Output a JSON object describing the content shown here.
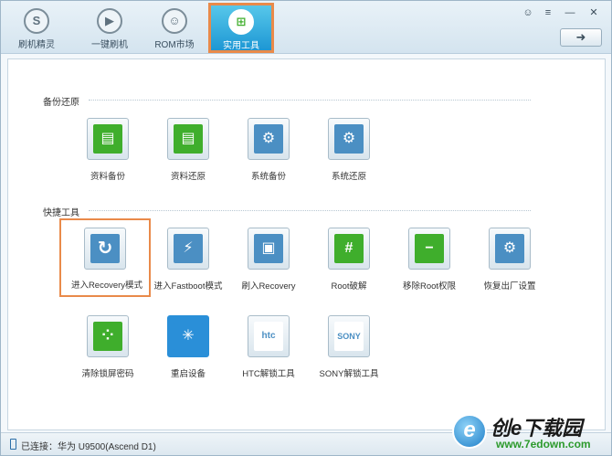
{
  "nav": {
    "items": [
      {
        "label": "刷机精灵",
        "icon": "S"
      },
      {
        "label": "一键刷机",
        "icon": "▶"
      },
      {
        "label": "ROM市场",
        "icon": "☺"
      },
      {
        "label": "实用工具",
        "icon": "⊞"
      }
    ],
    "active_index": 3
  },
  "window_controls": {
    "feedback": "☺",
    "menu": "≡",
    "minimize": "—",
    "close": "✕"
  },
  "refresh_button": {
    "glyph": "➜"
  },
  "sections": [
    {
      "title": "备份还原",
      "tools": [
        {
          "label": "资料备份",
          "glyph": "▤"
        },
        {
          "label": "资料还原",
          "glyph": "▤"
        },
        {
          "label": "系统备份",
          "glyph": "⚙"
        },
        {
          "label": "系统还原",
          "glyph": "⚙"
        }
      ]
    },
    {
      "title": "快捷工具",
      "tools": [
        {
          "label": "进入Recovery模式",
          "glyph": "↻"
        },
        {
          "label": "进入Fastboot模式",
          "glyph": "⚡"
        },
        {
          "label": "刷入Recovery",
          "glyph": "▣"
        },
        {
          "label": "Root破解",
          "glyph": "#"
        },
        {
          "label": "移除Root权限",
          "glyph": "−"
        },
        {
          "label": "恢复出厂设置",
          "glyph": "⚙"
        },
        {
          "label": "清除锁屏密码",
          "glyph": "⁘"
        },
        {
          "label": "重启设备",
          "glyph": "✳"
        },
        {
          "label": "HTC解锁工具",
          "glyph": "htc"
        },
        {
          "label": "SONY解锁工具",
          "glyph": "SONY"
        }
      ]
    }
  ],
  "status": {
    "text": "已连接：华为 U9500(Ascend D1)"
  },
  "watermark": {
    "title": "创e下载园",
    "url": "www.7edown.com",
    "logo_letter": "e"
  },
  "colors": {
    "accent": "#1d97d4",
    "highlight": "#e98a4a",
    "android_green": "#3fae2c",
    "tool_blue": "#4b8fc3"
  }
}
